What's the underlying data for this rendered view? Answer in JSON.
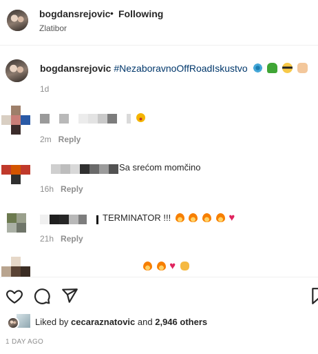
{
  "post_header": {
    "username": "bogdansrejovic",
    "separator": "•",
    "follow_state": "Following",
    "location": "Zlatibor"
  },
  "caption": {
    "username": "bogdansrejovic",
    "hashtag": "#NezaboravnoOffRoadIskustvo",
    "emoji_icons": [
      "snowflake-emoji",
      "green-figure-emoji",
      "sunglasses-face-emoji",
      "flexed-biceps-emoji"
    ],
    "time": "1d"
  },
  "comments": [
    {
      "username": "",
      "text": "",
      "emoji_icons": [
        "star-struck-face-emoji"
      ],
      "time": "2m",
      "reply": "Reply"
    },
    {
      "username": "",
      "text": "Sa srećom momčino",
      "time": "16h",
      "reply": "Reply"
    },
    {
      "username": "",
      "text": "TERMINATOR !!!",
      "emoji_icons": [
        "fire-emoji",
        "fire-emoji",
        "fire-emoji",
        "fire-emoji",
        "red-heart-emoji"
      ],
      "time": "21h",
      "reply": "Reply"
    },
    {
      "username": "",
      "text": "",
      "emoji_icons": [
        "fire-emoji",
        "fire-emoji",
        "red-heart-emoji",
        "clapping-hands-emoji"
      ],
      "time": "",
      "reply": ""
    }
  ],
  "actions": {
    "icons": [
      "heart-icon",
      "comment-icon",
      "share-icon",
      "bookmark-icon"
    ]
  },
  "likes": {
    "prefix": "Liked by",
    "user": "cecaraznatovic",
    "conj": "and",
    "count": "2,946 others"
  },
  "date": "1 DAY AGO",
  "colors": {
    "text": "#262626",
    "muted": "#8e8e8e",
    "link": "#00376b",
    "divider": "#efefef"
  }
}
